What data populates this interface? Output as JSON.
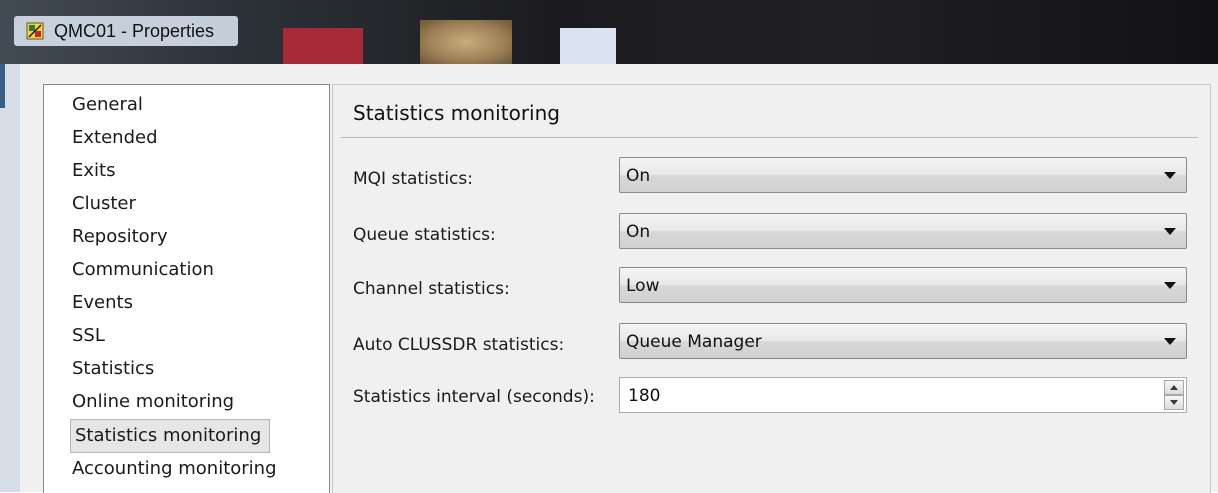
{
  "window": {
    "title": "QMC01 - Properties",
    "icon": "queue-manager-icon"
  },
  "nav": {
    "items": [
      {
        "label": "General"
      },
      {
        "label": "Extended"
      },
      {
        "label": "Exits"
      },
      {
        "label": "Cluster"
      },
      {
        "label": "Repository"
      },
      {
        "label": "Communication"
      },
      {
        "label": "Events"
      },
      {
        "label": "SSL"
      },
      {
        "label": "Statistics"
      },
      {
        "label": "Online monitoring"
      },
      {
        "label": "Statistics monitoring",
        "selected": true
      },
      {
        "label": "Accounting monitoring"
      }
    ]
  },
  "page": {
    "title": "Statistics monitoring",
    "fields": {
      "mqi": {
        "label": "MQI statistics:",
        "value": "On"
      },
      "queue": {
        "label": "Queue statistics:",
        "value": "On"
      },
      "channel": {
        "label": "Channel statistics:",
        "value": "Low"
      },
      "clussdr": {
        "label": "Auto CLUSSDR statistics:",
        "value": "Queue Manager"
      },
      "interval": {
        "label": "Statistics interval (seconds):",
        "value": "180"
      }
    }
  },
  "colors": {
    "selection_bg": "#e6e6e6",
    "dialog_bg": "#f0f0f0"
  }
}
